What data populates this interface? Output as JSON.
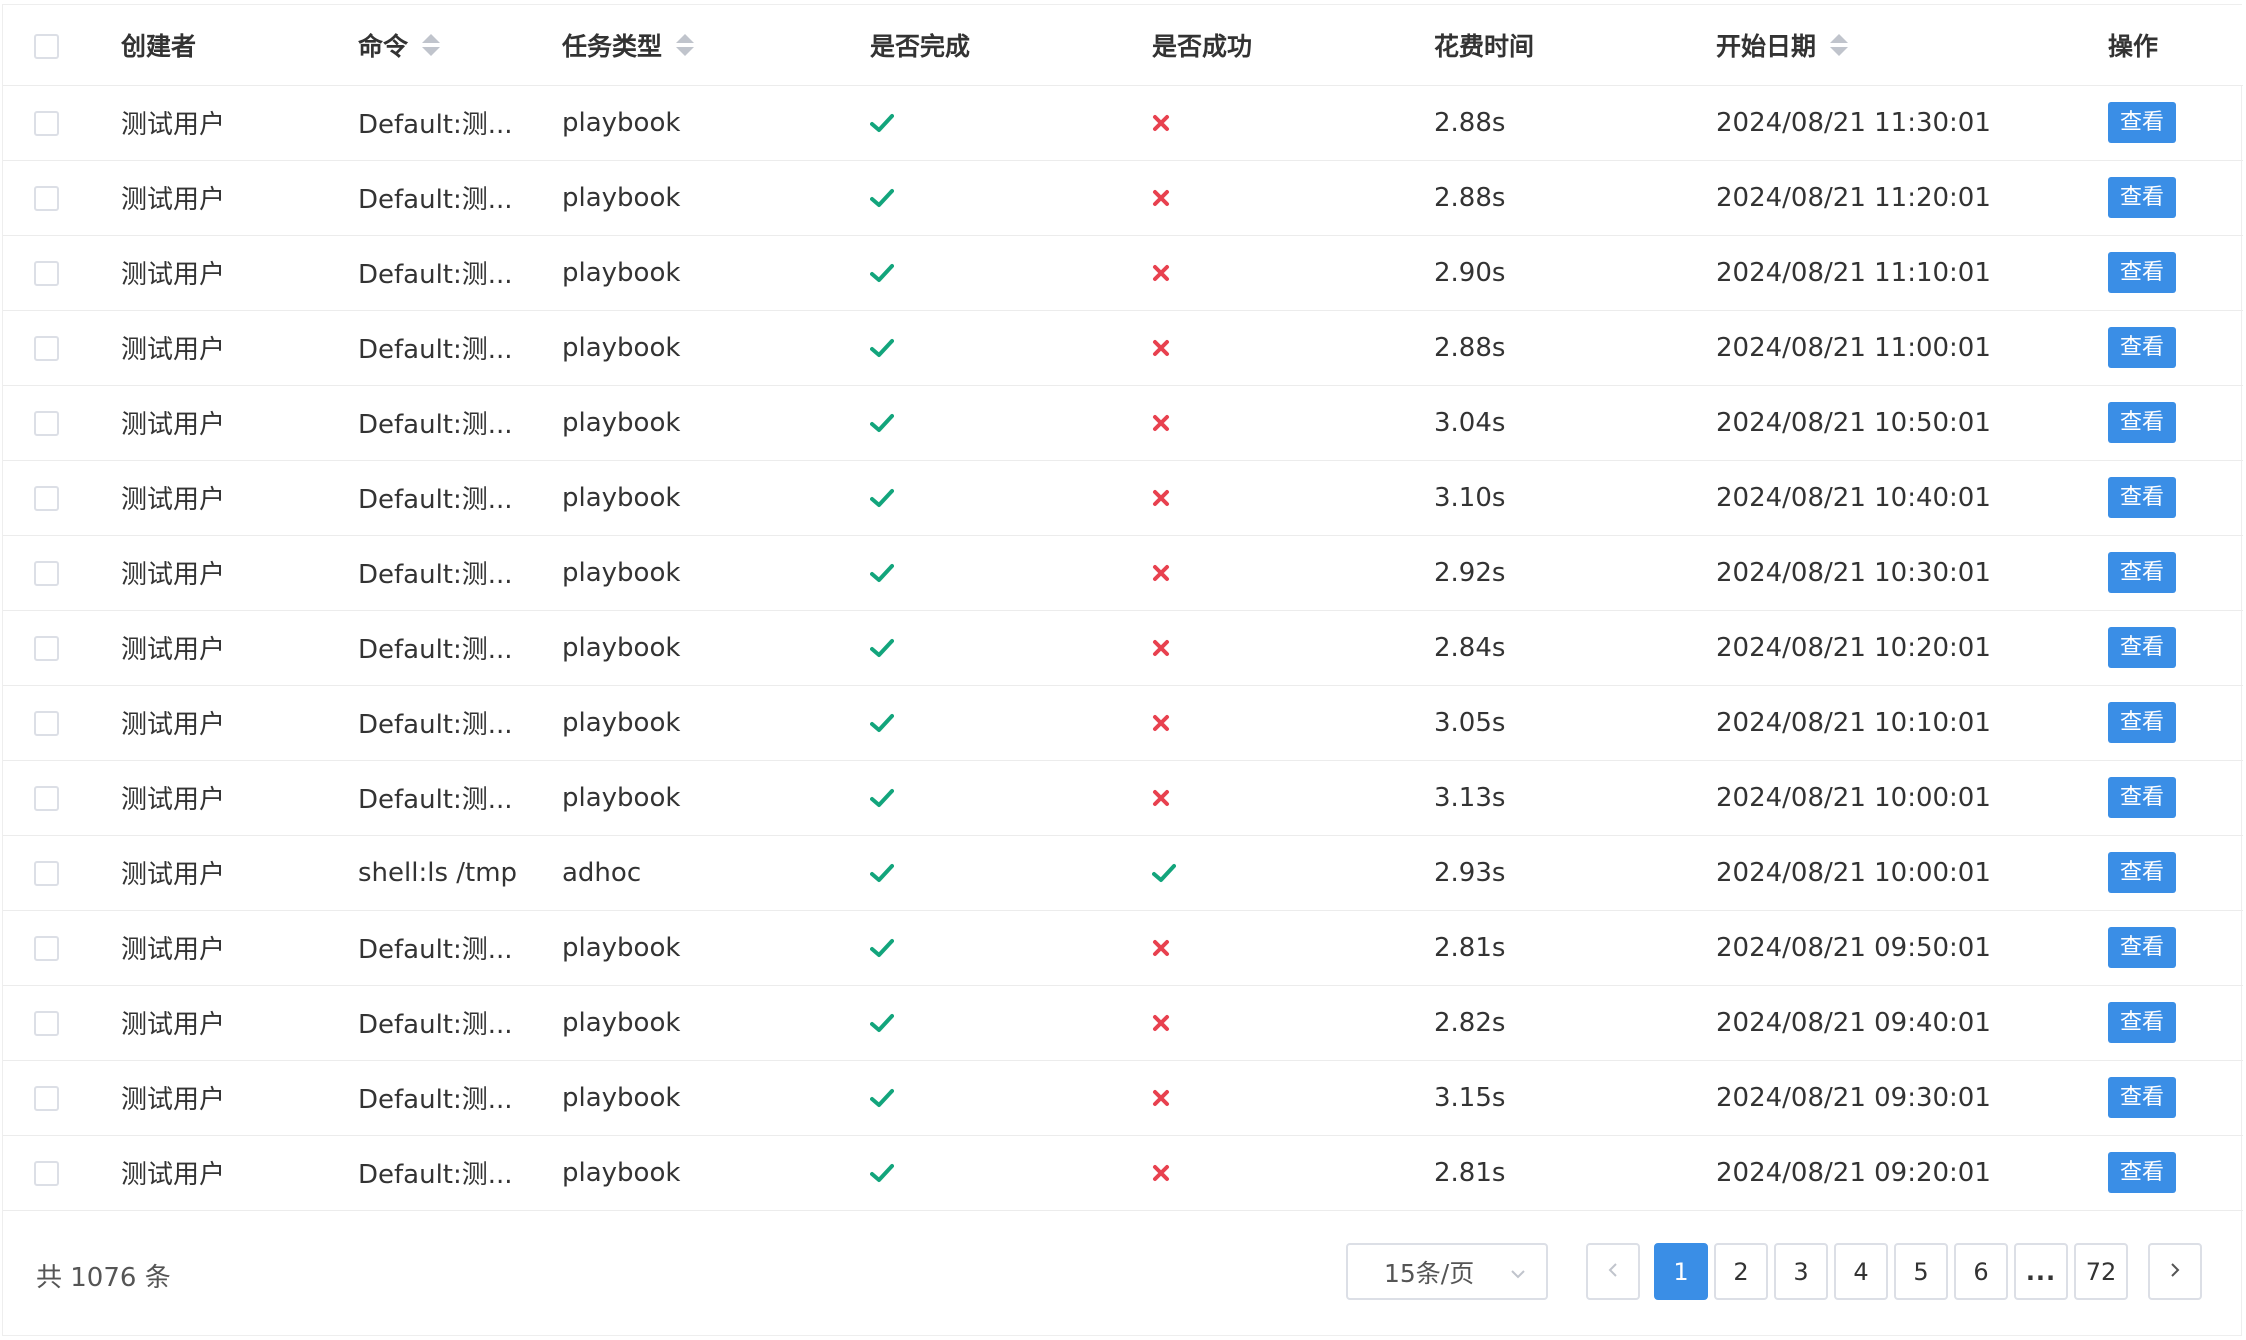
{
  "table": {
    "headers": {
      "creator": "创建者",
      "command": "命令",
      "task_type": "任务类型",
      "completed": "是否完成",
      "success": "是否成功",
      "duration": "花费时间",
      "start_date": "开始日期",
      "actions": "操作"
    },
    "rows": [
      {
        "creator": "测试用户",
        "command": "Default:测...",
        "task_type": "playbook",
        "completed": true,
        "success": false,
        "duration": "2.88s",
        "start_date": "2024/08/21 11:30:01",
        "action": "查看"
      },
      {
        "creator": "测试用户",
        "command": "Default:测...",
        "task_type": "playbook",
        "completed": true,
        "success": false,
        "duration": "2.88s",
        "start_date": "2024/08/21 11:20:01",
        "action": "查看"
      },
      {
        "creator": "测试用户",
        "command": "Default:测...",
        "task_type": "playbook",
        "completed": true,
        "success": false,
        "duration": "2.90s",
        "start_date": "2024/08/21 11:10:01",
        "action": "查看"
      },
      {
        "creator": "测试用户",
        "command": "Default:测...",
        "task_type": "playbook",
        "completed": true,
        "success": false,
        "duration": "2.88s",
        "start_date": "2024/08/21 11:00:01",
        "action": "查看"
      },
      {
        "creator": "测试用户",
        "command": "Default:测...",
        "task_type": "playbook",
        "completed": true,
        "success": false,
        "duration": "3.04s",
        "start_date": "2024/08/21 10:50:01",
        "action": "查看"
      },
      {
        "creator": "测试用户",
        "command": "Default:测...",
        "task_type": "playbook",
        "completed": true,
        "success": false,
        "duration": "3.10s",
        "start_date": "2024/08/21 10:40:01",
        "action": "查看"
      },
      {
        "creator": "测试用户",
        "command": "Default:测...",
        "task_type": "playbook",
        "completed": true,
        "success": false,
        "duration": "2.92s",
        "start_date": "2024/08/21 10:30:01",
        "action": "查看"
      },
      {
        "creator": "测试用户",
        "command": "Default:测...",
        "task_type": "playbook",
        "completed": true,
        "success": false,
        "duration": "2.84s",
        "start_date": "2024/08/21 10:20:01",
        "action": "查看"
      },
      {
        "creator": "测试用户",
        "command": "Default:测...",
        "task_type": "playbook",
        "completed": true,
        "success": false,
        "duration": "3.05s",
        "start_date": "2024/08/21 10:10:01",
        "action": "查看"
      },
      {
        "creator": "测试用户",
        "command": "Default:测...",
        "task_type": "playbook",
        "completed": true,
        "success": false,
        "duration": "3.13s",
        "start_date": "2024/08/21 10:00:01",
        "action": "查看"
      },
      {
        "creator": "测试用户",
        "command": "shell:ls /tmp",
        "task_type": "adhoc",
        "completed": true,
        "success": true,
        "duration": "2.93s",
        "start_date": "2024/08/21 10:00:01",
        "action": "查看"
      },
      {
        "creator": "测试用户",
        "command": "Default:测...",
        "task_type": "playbook",
        "completed": true,
        "success": false,
        "duration": "2.81s",
        "start_date": "2024/08/21 09:50:01",
        "action": "查看"
      },
      {
        "creator": "测试用户",
        "command": "Default:测...",
        "task_type": "playbook",
        "completed": true,
        "success": false,
        "duration": "2.82s",
        "start_date": "2024/08/21 09:40:01",
        "action": "查看"
      },
      {
        "creator": "测试用户",
        "command": "Default:测...",
        "task_type": "playbook",
        "completed": true,
        "success": false,
        "duration": "3.15s",
        "start_date": "2024/08/21 09:30:01",
        "action": "查看"
      },
      {
        "creator": "测试用户",
        "command": "Default:测...",
        "task_type": "playbook",
        "completed": true,
        "success": false,
        "duration": "2.81s",
        "start_date": "2024/08/21 09:20:01",
        "action": "查看"
      }
    ]
  },
  "pagination": {
    "total_text": "共 1076 条",
    "page_size": "15条/页",
    "pages": [
      "1",
      "2",
      "3",
      "4",
      "5",
      "6"
    ],
    "ellipsis": "...",
    "last_page": "72",
    "current_page": "1"
  },
  "icons": {
    "completed": "check-icon",
    "failed": "cross-icon",
    "sort": "sort-caret-icon",
    "prev": "chevron-left-icon",
    "next": "chevron-right-icon",
    "dropdown": "chevron-down-icon"
  },
  "colors": {
    "primary": "#3a8ee6",
    "success": "#13a57c",
    "danger": "#e8414f",
    "border": "#dcdfe6"
  }
}
